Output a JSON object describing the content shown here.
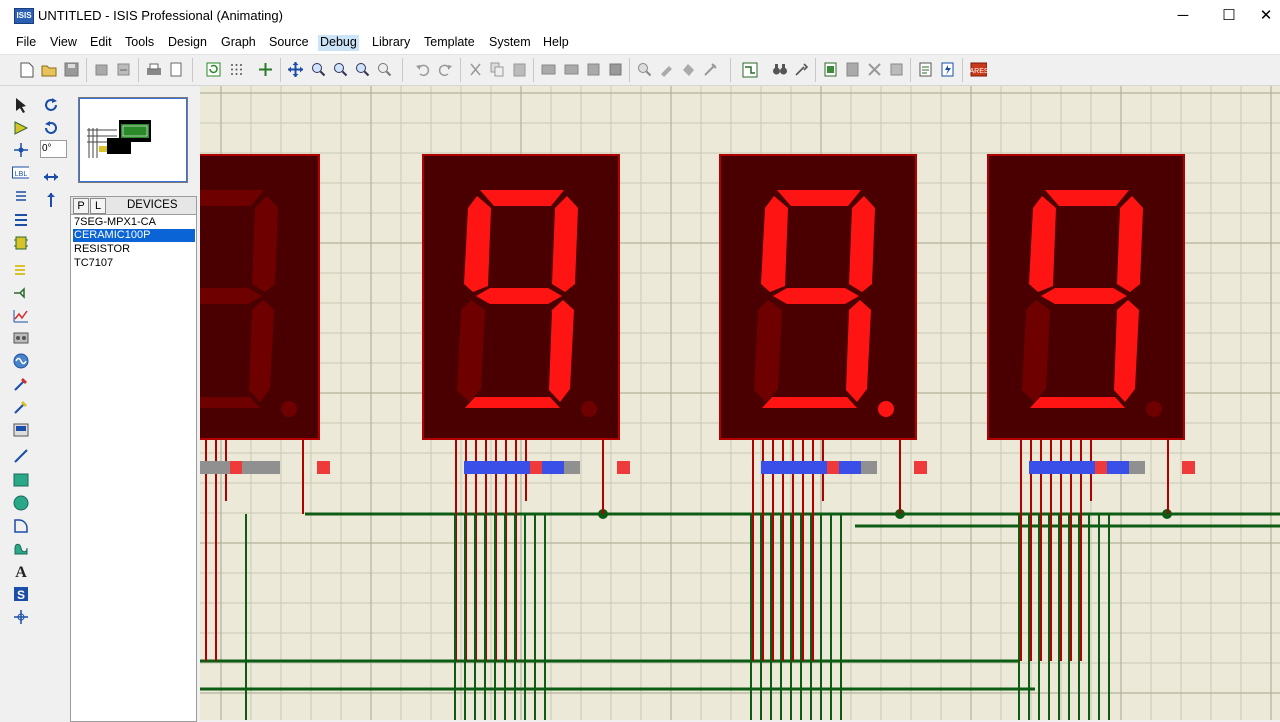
{
  "window": {
    "title": "UNTITLED - ISIS Professional (Animating)",
    "app_icon_text": "ISIS",
    "minimize": "─",
    "maximize": "☐",
    "close": "✕"
  },
  "menu": [
    "File",
    "View",
    "Edit",
    "Tools",
    "Design",
    "Graph",
    "Source",
    "Debug",
    "Library",
    "Template",
    "System",
    "Help"
  ],
  "rotation": {
    "value": "0°"
  },
  "devices": {
    "tab_p": "P",
    "tab_l": "L",
    "title": "DEVICES",
    "items": [
      "7SEG-MPX1-CA",
      "CERAMIC100P",
      "RESISTOR",
      "TC7107"
    ],
    "selected_index": 1
  },
  "canvas": {
    "background": "#ece9d8",
    "grid_color": "#c7c9b5",
    "wire_color": "#0d5c14",
    "segment_on": "#ff1414",
    "segment_off": "#6e0000",
    "display_body": "#4a0000",
    "displays": [
      {
        "digit": "partial",
        "segments_on": [],
        "dp": false
      },
      {
        "digit": "9",
        "segments_on": [
          "a",
          "b",
          "c",
          "d",
          "f",
          "g"
        ],
        "dp": false
      },
      {
        "digit": "9",
        "segments_on": [
          "a",
          "b",
          "c",
          "d",
          "f",
          "g"
        ],
        "dp": true
      },
      {
        "digit": "9",
        "segments_on": [
          "a",
          "b",
          "c",
          "d",
          "f",
          "g"
        ],
        "dp": false
      }
    ]
  }
}
